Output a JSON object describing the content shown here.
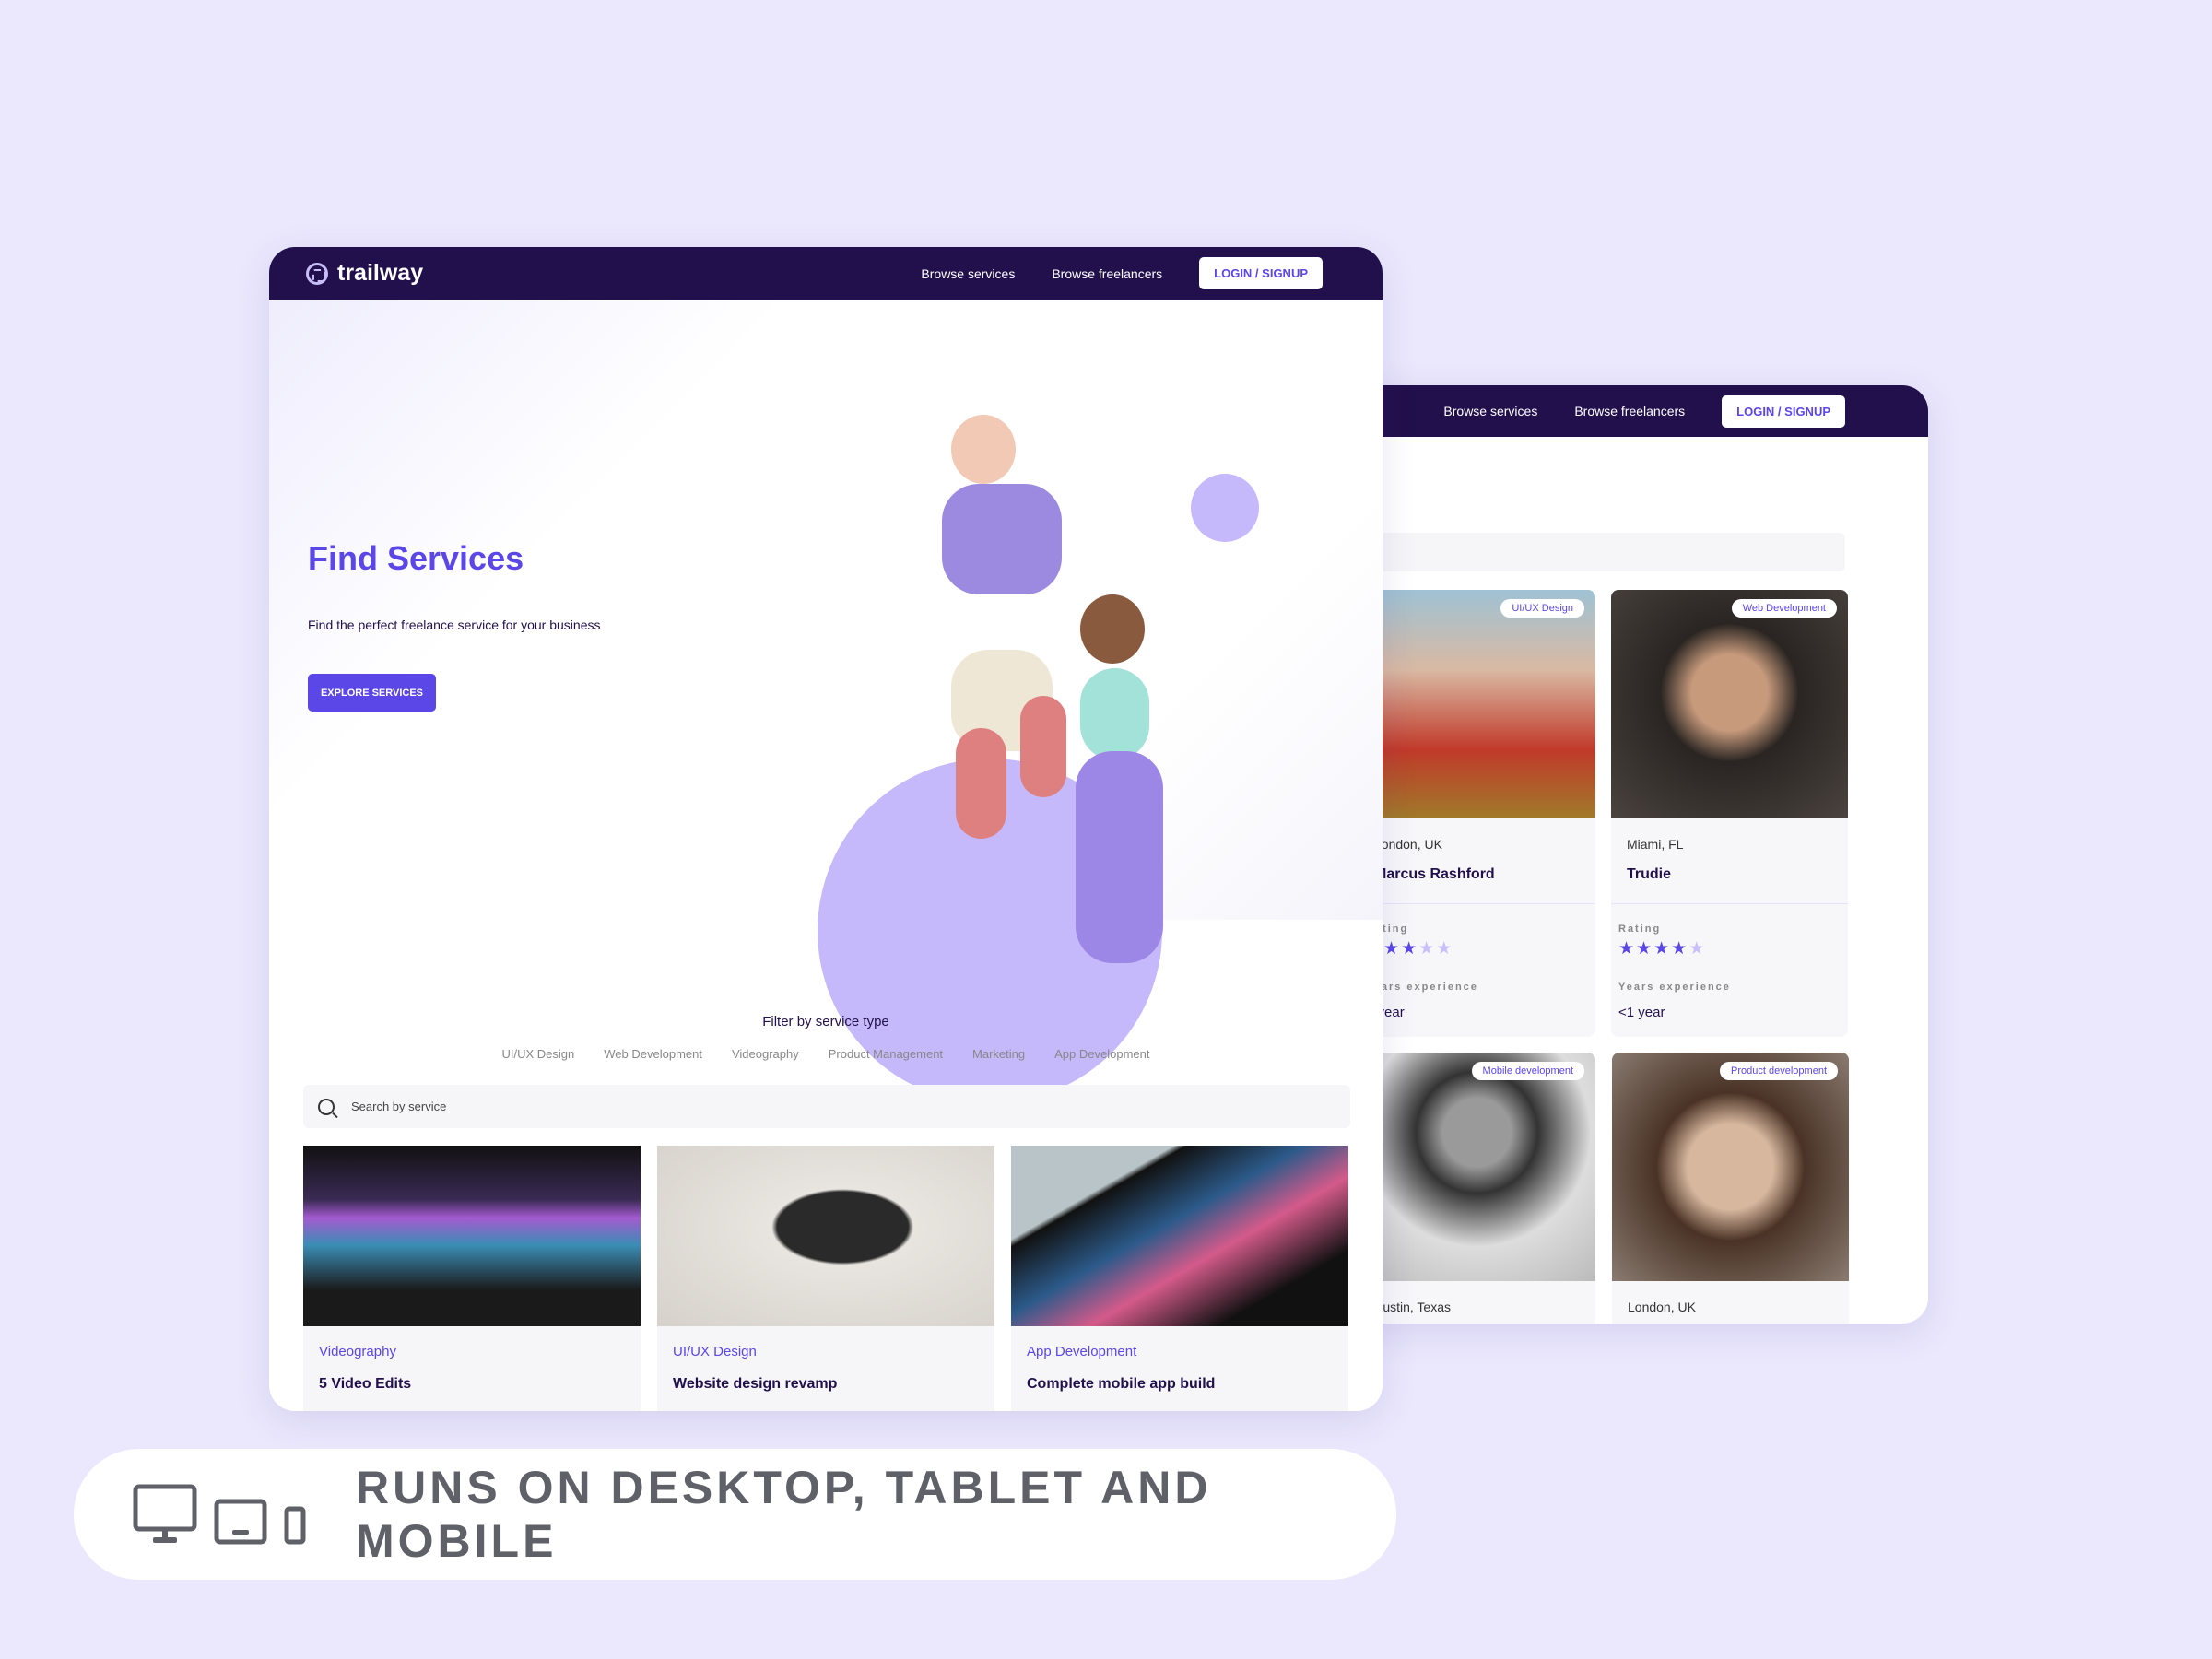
{
  "colors": {
    "accent": "#5b46e8",
    "nav": "#22104c",
    "lavender": "#c6b9fb",
    "background": "#ebe8fd"
  },
  "front": {
    "brand": "trailway",
    "nav": {
      "browse_services": "Browse services",
      "browse_freelancers": "Browse freelancers",
      "login": "LOGIN / SIGNUP"
    },
    "hero": {
      "title": "Find Services",
      "subtitle": "Find the perfect freelance service for your business",
      "cta": "EXPLORE SERVICES"
    },
    "filter": {
      "title": "Filter by service type",
      "chips": [
        "UI/UX Design",
        "Web Development",
        "Videography",
        "Product Management",
        "Marketing",
        "App Development"
      ]
    },
    "search": {
      "placeholder": "Search by service"
    },
    "services": [
      {
        "category": "Videography",
        "title": "5 Video Edits"
      },
      {
        "category": "UI/UX Design",
        "title": "Website design revamp"
      },
      {
        "category": "App Development",
        "title": "Complete mobile app build"
      }
    ]
  },
  "back": {
    "nav": {
      "browse_services": "Browse services",
      "browse_freelancers": "Browse freelancers",
      "login": "LOGIN / SIGNUP"
    },
    "labels": {
      "rating": "Rating",
      "experience": "Years experience"
    },
    "freelancers": [
      {
        "badge": "UI/UX Design",
        "location": "London, UK",
        "name": "Marcus Rashford",
        "rating": 3,
        "experience": "1 year"
      },
      {
        "badge": "Web Development",
        "location": "Miami, FL",
        "name": "Trudie",
        "rating": 4,
        "experience": "<1 year"
      },
      {
        "badge": "Mobile development",
        "location": "Austin, Texas"
      },
      {
        "badge": "Product development",
        "location": "London, UK"
      }
    ]
  },
  "banner": {
    "text": "RUNS ON DESKTOP, TABLET AND MOBILE",
    "icons": [
      "desktop-icon",
      "tablet-icon",
      "mobile-icon"
    ]
  }
}
